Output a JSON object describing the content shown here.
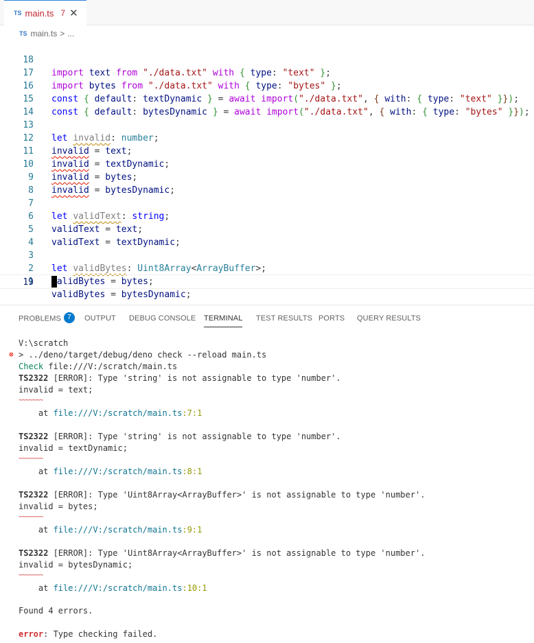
{
  "tab": {
    "badge": "TS",
    "name": "main.ts",
    "problem_count": "7",
    "close": "✕"
  },
  "breadcrumb": {
    "badge": "TS",
    "file": "main.ts",
    "sep": ">",
    "rest": "..."
  },
  "editor_lines": [
    {
      "ln": "18"
    },
    {
      "ln": "17"
    },
    {
      "ln": "16"
    },
    {
      "ln": "15"
    },
    {
      "ln": "14"
    },
    {
      "ln": "13"
    },
    {
      "ln": "12"
    },
    {
      "ln": "11"
    },
    {
      "ln": "10"
    },
    {
      "ln": "9"
    },
    {
      "ln": "8"
    },
    {
      "ln": "7"
    },
    {
      "ln": "6"
    },
    {
      "ln": "5"
    },
    {
      "ln": "4"
    },
    {
      "ln": "3"
    },
    {
      "ln": "2"
    },
    {
      "ln": "1"
    },
    {
      "ln": "19"
    }
  ],
  "code": {
    "import": "import",
    "from": "from",
    "with": "with",
    "type": "type",
    "const": "const",
    "default": "default",
    "await": "await",
    "let": "let",
    "text": "text",
    "bytes": "bytes",
    "data_path": "\"./data.txt\"",
    "text_str": "\"text\"",
    "bytes_str": "\"bytes\"",
    "textDynamic": "textDynamic",
    "bytesDynamic": "bytesDynamic",
    "invalid": "invalid",
    "validText": "validText",
    "validBytes": "validBytes",
    "number": "number",
    "string": "string",
    "Uint8Array": "Uint8Array",
    "ArrayBuffer": "ArrayBuffer"
  },
  "panel": {
    "tabs": [
      {
        "label": "PROBLEMS"
      },
      {
        "label": "OUTPUT"
      },
      {
        "label": "DEBUG CONSOLE"
      },
      {
        "label": "TERMINAL"
      },
      {
        "label": "TEST RESULTS"
      },
      {
        "label": "PORTS"
      },
      {
        "label": "QUERY RESULTS"
      }
    ],
    "problems_badge": "7"
  },
  "terminal": {
    "cwd": "V:\\scratch",
    "command_prompt": "> ",
    "command": "../deno/target/debug/deno check --reload main.ts",
    "check_label": "Check",
    "check_file": " file:///V:/scratch/main.ts",
    "errors": [
      {
        "code": "TS2322",
        "message": " [ERROR]: Type 'string' is not assignable to type 'number'.",
        "source": "invalid = text;",
        "squiggle": "~~~~~~~",
        "at": "    at ",
        "file": "file:///V:/scratch/main.ts",
        "loc": ":7:1"
      },
      {
        "code": "TS2322",
        "message": " [ERROR]: Type 'string' is not assignable to type 'number'.",
        "source": "invalid = textDynamic;",
        "squiggle": "~~~~~~~",
        "at": "    at ",
        "file": "file:///V:/scratch/main.ts",
        "loc": ":8:1"
      },
      {
        "code": "TS2322",
        "message": " [ERROR]: Type 'Uint8Array<ArrayBuffer>' is not assignable to type 'number'.",
        "source": "invalid = bytes;",
        "squiggle": "~~~~~~~",
        "at": "    at ",
        "file": "file:///V:/scratch/main.ts",
        "loc": ":9:1"
      },
      {
        "code": "TS2322",
        "message": " [ERROR]: Type 'Uint8Array<ArrayBuffer>' is not assignable to type 'number'.",
        "source": "invalid = bytesDynamic;",
        "squiggle": "~~~~~~~",
        "at": "    at ",
        "file": "file:///V:/scratch/main.ts",
        "loc": ":10:1"
      }
    ],
    "found": "Found 4 errors.",
    "final_error_label": "error",
    "final_error_msg": ": Type checking failed."
  }
}
